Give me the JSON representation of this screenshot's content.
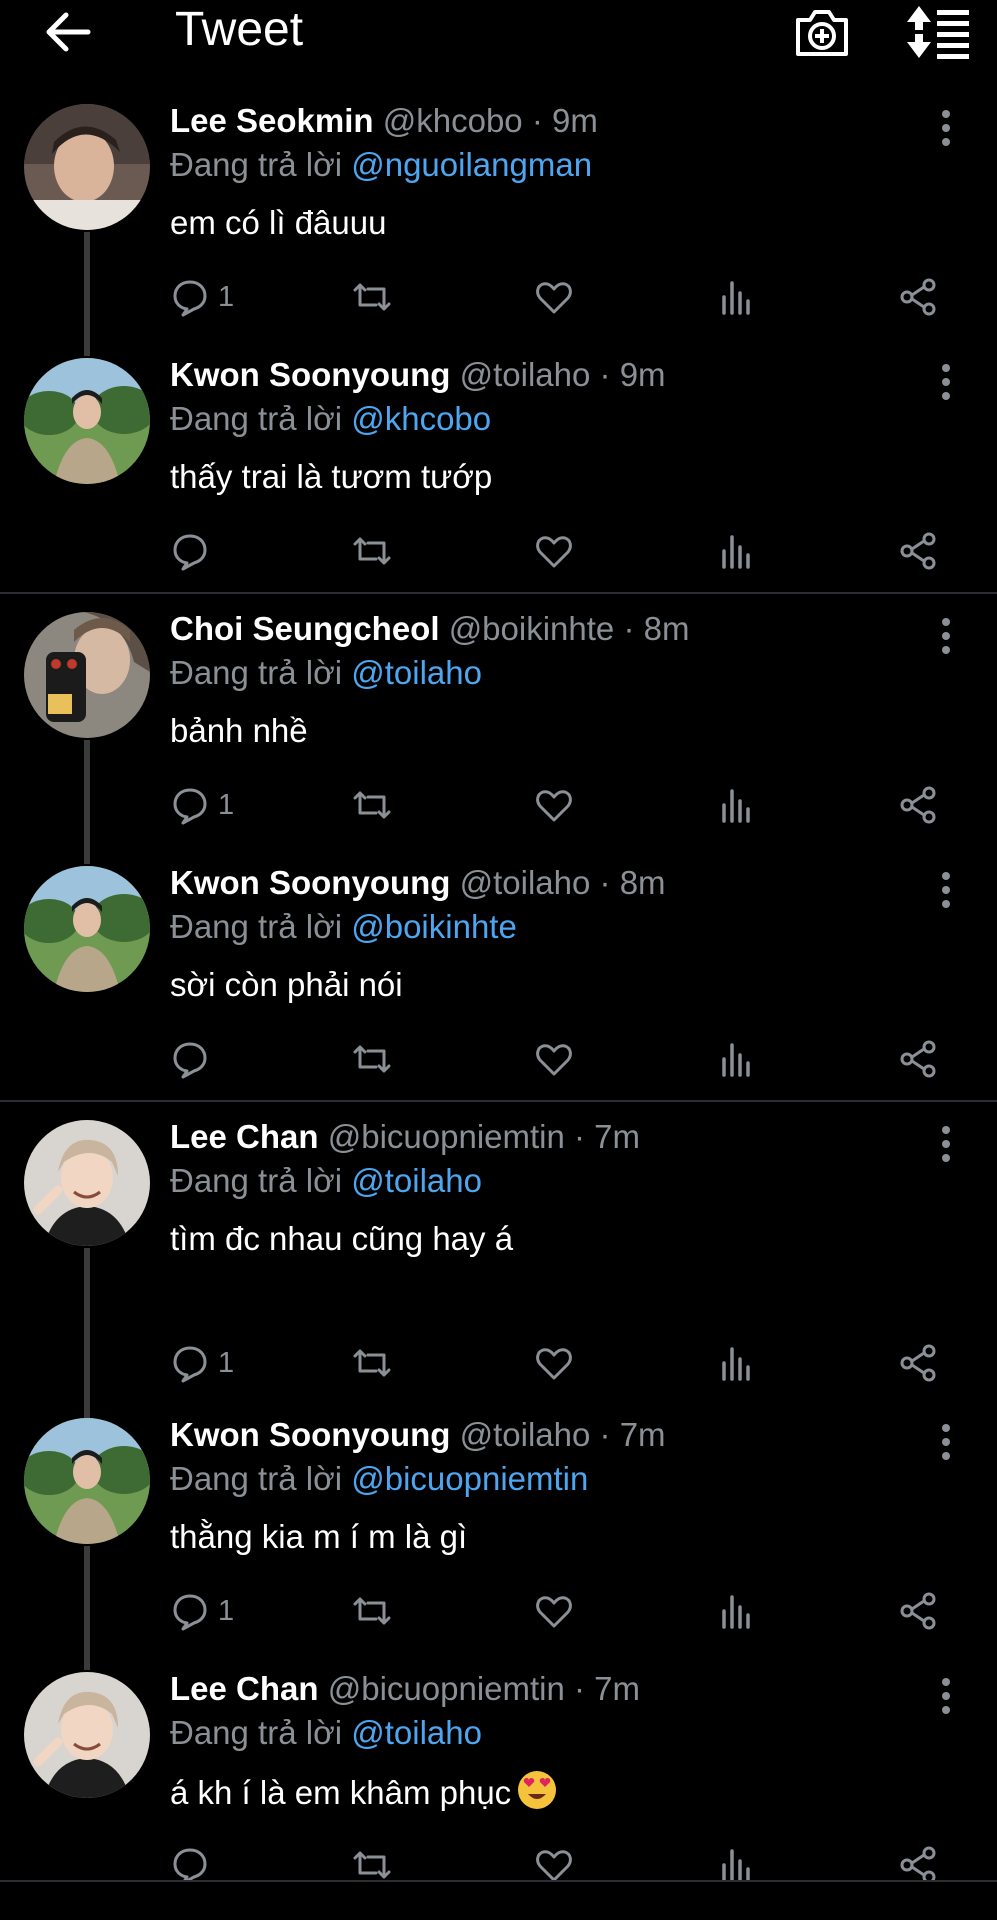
{
  "header": {
    "title": "Tweet",
    "back_icon": "arrow-left-icon",
    "camera_icon": "camera-plus-icon",
    "sort_icon": "sort-icon"
  },
  "reply_prefix": "Đang trả lời",
  "tweets": [
    {
      "name": "Lee Seokmin",
      "meta": "@khcobo · 9m",
      "mention": "@nguoilangman",
      "text": "em có lì đâuuu",
      "replies": "1"
    },
    {
      "name": "Kwon Soonyoung",
      "meta": "@toilaho · 9m",
      "mention": "@khcobo",
      "text": "thấy trai là tươm tướp",
      "replies": ""
    },
    {
      "name": "Choi Seungcheol",
      "meta": "@boikinhte · 8m",
      "mention": "@toilaho",
      "text": "bảnh nhề",
      "replies": "1"
    },
    {
      "name": "Kwon Soonyoung",
      "meta": "@toilaho · 8m",
      "mention": "@boikinhte",
      "text": "sời còn phải nói",
      "replies": ""
    },
    {
      "name": "Lee Chan",
      "meta": "@bicuopniemtin · 7m",
      "mention": "@toilaho",
      "text": "tìm đc nhau cũng hay á",
      "replies": "1"
    },
    {
      "name": "Kwon Soonyoung",
      "meta": "@toilaho · 7m",
      "mention": "@bicuopniemtin",
      "text": "thằng kia m í m là gì",
      "replies": "1"
    },
    {
      "name": "Lee Chan",
      "meta": "@bicuopniemtin · 7m",
      "mention": "@toilaho",
      "text": "á kh í là em khâm phục",
      "replies": ""
    }
  ],
  "colors": {
    "background": "#000000",
    "mention": "#4ea6f0",
    "muted": "#8b9096",
    "text": "#ffffff"
  }
}
